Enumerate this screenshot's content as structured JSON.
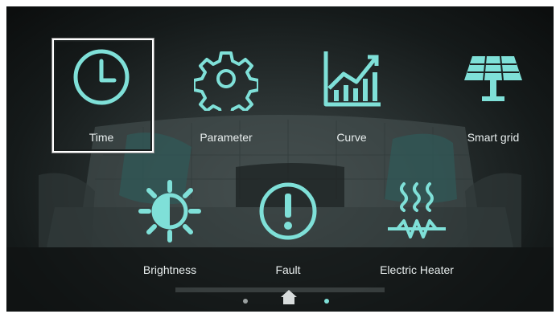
{
  "menu": {
    "items": [
      {
        "id": "time",
        "label": "Time",
        "icon": "clock-icon",
        "selected": true
      },
      {
        "id": "parameter",
        "label": "Parameter",
        "icon": "gear-icon"
      },
      {
        "id": "curve",
        "label": "Curve",
        "icon": "chart-icon"
      },
      {
        "id": "smart_grid",
        "label": "Smart grid",
        "icon": "solar-panel-icon"
      },
      {
        "id": "brightness",
        "label": "Brightness",
        "icon": "brightness-icon"
      },
      {
        "id": "fault",
        "label": "Fault",
        "icon": "alert-icon"
      },
      {
        "id": "electric_heater",
        "label": "Electric Heater",
        "icon": "heater-icon"
      }
    ]
  },
  "pager": {
    "current_page_icon": "home-icon",
    "dot_color": "#9aa0a0",
    "active_dot_color": "#7fe0d8"
  },
  "colors": {
    "icon": "#7fe0d8",
    "label": "#e8eeee",
    "selection_border": "#ffffff"
  }
}
